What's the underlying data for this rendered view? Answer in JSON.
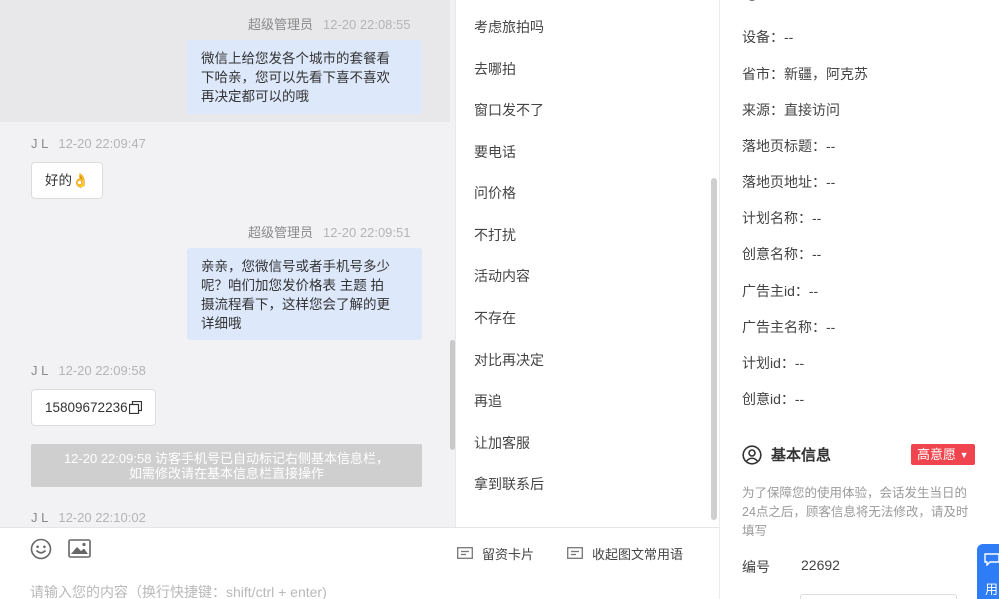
{
  "chat": {
    "messages": [
      {
        "dir": "out",
        "sender": "超级管理员",
        "time": "12-20 22:08:55",
        "lines": [
          "微信上给您发各个城市的套餐看",
          "下哈亲，您可以先看下喜不喜欢",
          "再决定都可以的哦"
        ]
      },
      {
        "dir": "in",
        "sender": "J L",
        "time": "12-20 22:09:47",
        "text": "好的👌"
      },
      {
        "dir": "out",
        "sender": "超级管理员",
        "time": "12-20 22:09:51",
        "lines": [
          "亲亲，您微信号或者手机号多少",
          "呢？咱们加您发价格表 主题 拍",
          "摄流程看下，这样您会了解的更",
          "详细哦"
        ]
      },
      {
        "dir": "in",
        "sender": "J L",
        "time": "12-20 22:09:58",
        "text": "15809672236"
      },
      {
        "dir": "in",
        "sender": "J L",
        "time": "12-20 22:10:02",
        "text": ""
      }
    ],
    "system_note_lines": [
      "12-20 22:09:58 访客手机号已自动标记右侧基本信息栏，",
      "如需修改请在基本信息栏直接操作"
    ]
  },
  "composer": {
    "emoji_icon": "smile-icon",
    "image_icon": "image-icon",
    "card_label": "留资卡片",
    "collapse_label": "收起图文常用语",
    "placeholder": "请输入您的内容（换行快捷键：shift/ctrl + enter)"
  },
  "phrases": [
    "考虑旅拍吗",
    "去哪拍",
    "窗口发不了",
    "要电话",
    "问价格",
    "不打扰",
    "活动内容",
    "不存在",
    "对比再决定",
    "再追",
    "让加客服",
    "拿到联系后"
  ],
  "info": {
    "rows": [
      "设备：--",
      "省市：新疆，阿克苏",
      "来源：直接访问",
      "落地页标题：--",
      "落地页地址：--",
      "计划名称：--",
      "创意名称：--",
      "广告主id：--",
      "广告主名称：--",
      "计划id：--",
      "创意id：--"
    ],
    "basic": {
      "title": "基本信息",
      "badge": "高意愿",
      "badge_color": "#f0454e",
      "note": "为了保障您的使用体验，会话发生当日的24点之后，顾客信息将无法修改，请及时填写",
      "id_label": "编号",
      "id_value": "22692"
    },
    "float_button": "用"
  },
  "colors": {
    "accent": "#2e7cf6",
    "bubble_out": "#dde8fb"
  }
}
